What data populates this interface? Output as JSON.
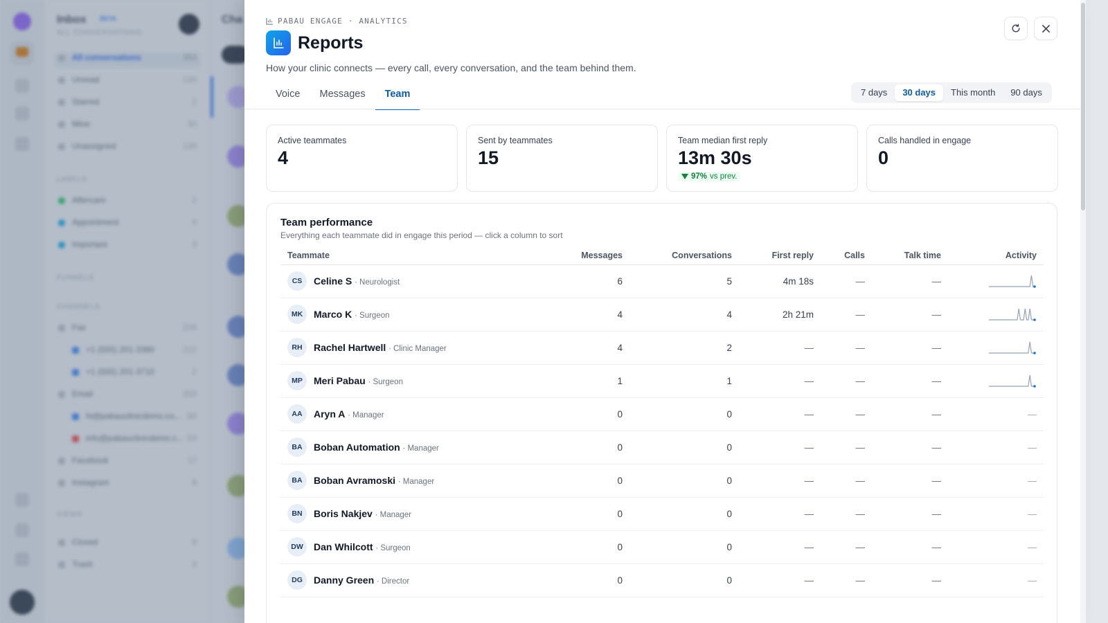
{
  "background": {
    "inbox_title": "Inbox",
    "inbox_badge": "BETA",
    "inbox_subtitle": "ALL CONVERSATIONS",
    "list_title": "Cha",
    "nav": [
      {
        "label": "All conversations",
        "count": "353",
        "selected": true
      },
      {
        "label": "Unread",
        "count": "120"
      },
      {
        "label": "Starred",
        "count": "2"
      },
      {
        "label": "Mine",
        "count": "30"
      },
      {
        "label": "Unassigned",
        "count": "120"
      }
    ],
    "sections": [
      {
        "label": "LABELS"
      },
      {
        "label": "FUNNELS"
      },
      {
        "label": "CHANNELS"
      },
      {
        "label": "VIEWS"
      }
    ],
    "labels": [
      {
        "label": "Aftercare",
        "count": "2",
        "color": "#22c55e"
      },
      {
        "label": "Appointment",
        "count": "4",
        "color": "#0ea5e9"
      },
      {
        "label": "Important",
        "count": "3",
        "color": "#0ea5e9"
      }
    ],
    "channels": [
      {
        "label": "Fax",
        "count": "226"
      },
      {
        "label": "+1 (555) 201-3380",
        "count": "212"
      },
      {
        "label": "+1 (555) 201-3710",
        "count": "2"
      },
      {
        "label": "Email",
        "count": "203"
      },
      {
        "label": "hi@pabauclinicdemo.co...",
        "count": "80"
      },
      {
        "label": "info@pabauclinicdemo.c...",
        "count": "53"
      },
      {
        "label": "Facebook",
        "count": "17"
      },
      {
        "label": "Instagram",
        "count": "8"
      }
    ],
    "views": [
      {
        "label": "Closed",
        "count": "9"
      },
      {
        "label": "Trash",
        "count": "3"
      }
    ]
  },
  "header": {
    "eyebrow": "PABAU ENGAGE · ANALYTICS",
    "title": "Reports",
    "subtitle": "How your clinic connects — every call, every conversation, and the team behind them."
  },
  "tabs": [
    {
      "label": "Voice",
      "active": false
    },
    {
      "label": "Messages",
      "active": false
    },
    {
      "label": "Team",
      "active": true
    }
  ],
  "date_range": {
    "options": [
      "7 days",
      "30 days",
      "This month",
      "90 days"
    ],
    "selected": "30 days"
  },
  "kpis": [
    {
      "label": "Active teammates",
      "value": "4"
    },
    {
      "label": "Sent by teammates",
      "value": "15"
    },
    {
      "label": "Team median first reply",
      "value": "13m 30s",
      "delta": "97%",
      "delta_suffix": "vs prev.",
      "delta_direction": "down"
    },
    {
      "label": "Calls handled in engage",
      "value": "0"
    }
  ],
  "team_performance": {
    "title": "Team performance",
    "subtitle": "Everything each teammate did in engage this period — click a column to sort",
    "columns": [
      "Teammate",
      "Messages",
      "Conversations",
      "First reply",
      "Calls",
      "Talk time",
      "Activity"
    ],
    "rows": [
      {
        "initials": "CS",
        "name": "Celine S",
        "role": "· Neurologist",
        "messages": "6",
        "conversations": "5",
        "first_reply": "4m 18s",
        "calls": "—",
        "talk_time": "—",
        "activity": [
          0,
          0,
          0,
          0,
          0,
          0,
          0,
          0,
          0,
          0,
          0,
          0,
          0,
          0,
          0,
          0,
          0,
          0,
          0,
          0,
          0,
          0,
          0,
          0,
          0,
          0,
          0,
          1,
          0,
          0
        ],
        "activity_empty": "—"
      },
      {
        "initials": "MK",
        "name": "Marco K",
        "role": "· Surgeon",
        "messages": "4",
        "conversations": "4",
        "first_reply": "2h 21m",
        "calls": "—",
        "talk_time": "—",
        "activity": [
          0,
          0,
          0,
          0,
          0,
          0,
          0,
          0,
          0,
          0,
          0,
          0,
          0,
          0,
          0,
          0,
          0,
          0,
          0,
          1,
          0,
          0,
          0,
          1,
          0,
          0,
          1,
          0,
          0,
          0
        ],
        "activity_empty": "—"
      },
      {
        "initials": "RH",
        "name": "Rachel Hartwell",
        "role": "· Clinic Manager",
        "messages": "4",
        "conversations": "2",
        "first_reply": "—",
        "calls": "—",
        "talk_time": "—",
        "activity": [
          0,
          0,
          0,
          0,
          0,
          0,
          0,
          0,
          0,
          0,
          0,
          0,
          0,
          0,
          0,
          0,
          0,
          0,
          0,
          0,
          0,
          0,
          0,
          0,
          0,
          0,
          1,
          0,
          0,
          0
        ],
        "activity_empty": "—"
      },
      {
        "initials": "MP",
        "name": "Meri Pabau",
        "role": "· Surgeon",
        "messages": "1",
        "conversations": "1",
        "first_reply": "—",
        "calls": "—",
        "talk_time": "—",
        "activity": [
          0,
          0,
          0,
          0,
          0,
          0,
          0,
          0,
          0,
          0,
          0,
          0,
          0,
          0,
          0,
          0,
          0,
          0,
          0,
          0,
          0,
          0,
          0,
          0,
          0,
          0,
          1,
          0,
          0,
          0
        ],
        "activity_empty": "—"
      },
      {
        "initials": "AA",
        "name": "Aryn A",
        "role": "· Manager",
        "messages": "0",
        "conversations": "0",
        "first_reply": "—",
        "calls": "—",
        "talk_time": "—",
        "activity": [],
        "activity_empty": "—"
      },
      {
        "initials": "BA",
        "name": "Boban Automation",
        "role": "· Manager",
        "messages": "0",
        "conversations": "0",
        "first_reply": "—",
        "calls": "—",
        "talk_time": "—",
        "activity": [],
        "activity_empty": "—"
      },
      {
        "initials": "BA",
        "name": "Boban Avramoski",
        "role": "· Manager",
        "messages": "0",
        "conversations": "0",
        "first_reply": "—",
        "calls": "—",
        "talk_time": "—",
        "activity": [],
        "activity_empty": "—"
      },
      {
        "initials": "BN",
        "name": "Boris Nakjev",
        "role": "· Manager",
        "messages": "0",
        "conversations": "0",
        "first_reply": "—",
        "calls": "—",
        "talk_time": "—",
        "activity": [],
        "activity_empty": "—"
      },
      {
        "initials": "DW",
        "name": "Dan Whilcott",
        "role": "· Surgeon",
        "messages": "0",
        "conversations": "0",
        "first_reply": "—",
        "calls": "—",
        "talk_time": "—",
        "activity": [],
        "activity_empty": "—"
      },
      {
        "initials": "DG",
        "name": "Danny Green",
        "role": "· Director",
        "messages": "0",
        "conversations": "0",
        "first_reply": "—",
        "calls": "—",
        "talk_time": "—",
        "activity": [],
        "activity_empty": "—"
      }
    ]
  },
  "colors": {
    "accent": "#0b6fc2",
    "title_icon": "#0ea5e9",
    "delta_good": "#15803d",
    "sparkline": "#94a3b8",
    "sparkline_dot": "#1d6fd6"
  },
  "icons": {
    "eyebrow": "bar-chart-icon",
    "title": "bar-chart-icon",
    "refresh": "refresh-icon",
    "close": "close-icon"
  }
}
